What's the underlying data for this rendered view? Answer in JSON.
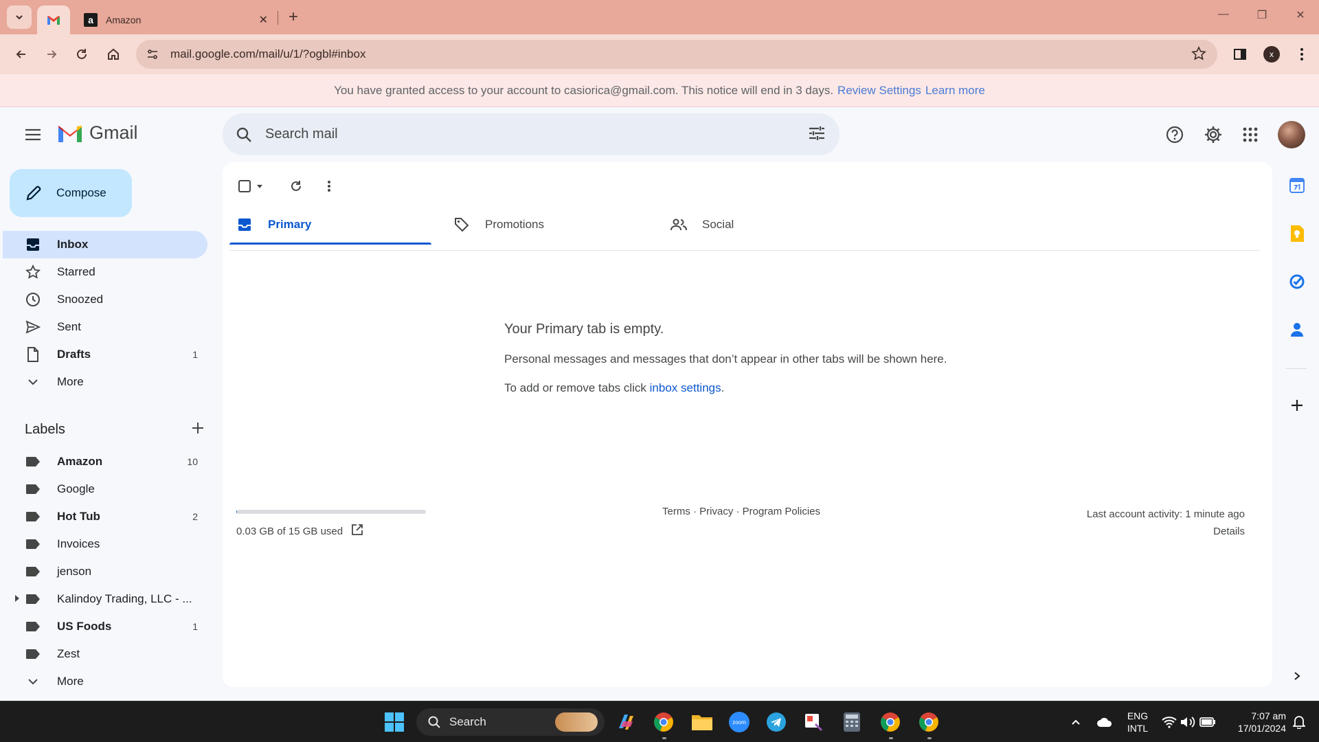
{
  "browser": {
    "tabs": [
      {
        "title": ""
      },
      {
        "title": "Amazon"
      }
    ],
    "url": "mail.google.com/mail/u/1/?ogbl#inbox"
  },
  "notice": {
    "text": "You have granted access to your account to casiorica@gmail.com. This notice will end in 3 days.",
    "review_link": "Review Settings",
    "learn_link": "Learn more"
  },
  "header": {
    "logo_text": "Gmail",
    "search_placeholder": "Search mail"
  },
  "compose": {
    "label": "Compose"
  },
  "nav": {
    "items": [
      {
        "label": "Inbox",
        "count": ""
      },
      {
        "label": "Starred",
        "count": ""
      },
      {
        "label": "Snoozed",
        "count": ""
      },
      {
        "label": "Sent",
        "count": ""
      },
      {
        "label": "Drafts",
        "count": "1"
      },
      {
        "label": "More",
        "count": ""
      }
    ]
  },
  "labels": {
    "title": "Labels",
    "items": [
      {
        "label": "Amazon",
        "count": "10"
      },
      {
        "label": "Google",
        "count": ""
      },
      {
        "label": "Hot Tub",
        "count": "2"
      },
      {
        "label": "Invoices",
        "count": ""
      },
      {
        "label": "jenson",
        "count": ""
      },
      {
        "label": "Kalindoy Trading, LLC - ...",
        "count": ""
      },
      {
        "label": "US Foods",
        "count": "1"
      },
      {
        "label": "Zest",
        "count": ""
      },
      {
        "label": "More",
        "count": ""
      }
    ]
  },
  "main": {
    "tabs": [
      {
        "label": "Primary"
      },
      {
        "label": "Promotions"
      },
      {
        "label": "Social"
      }
    ],
    "empty": {
      "title": "Your Primary tab is empty.",
      "line1": "Personal messages and messages that don’t appear in other tabs will be shown here.",
      "line2_prefix": "To add or remove tabs click ",
      "line2_link": "inbox settings",
      "line2_suffix": "."
    },
    "storage": {
      "text": "0.03 GB of 15 GB used",
      "used_fraction": 0.002
    },
    "footer": {
      "links": "Terms · Privacy · Program Policies"
    },
    "activity": {
      "line1": "Last account activity: 1 minute ago",
      "line2": "Details"
    }
  },
  "taskbar": {
    "search_label": "Search",
    "lang_line1": "ENG",
    "lang_line2": "INTL",
    "time": "7:07 am",
    "date": "17/01/2024"
  },
  "colors": {
    "accent": "#0b57d0",
    "compose_bg": "#c2e7ff",
    "active_nav_bg": "#d3e3fd",
    "browser_frame": "#e8a99a"
  }
}
